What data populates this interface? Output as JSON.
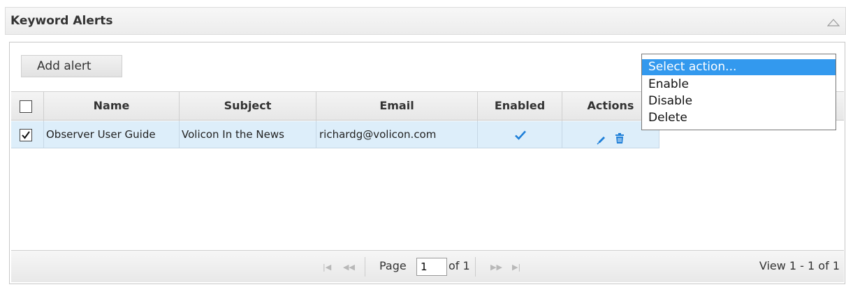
{
  "panel": {
    "title": "Keyword Alerts"
  },
  "toolbar": {
    "add_label": "Add alert"
  },
  "grid": {
    "columns": [
      "Name",
      "Subject",
      "Email",
      "Enabled",
      "Actions"
    ],
    "rows": [
      {
        "checked": true,
        "name": "Observer User Guide",
        "subject": "Volicon In the News",
        "email": "richardg@volicon.com",
        "enabled": true
      }
    ]
  },
  "pager": {
    "page_label": "Page",
    "page_value": "1",
    "of_label": "of 1",
    "view_label": "View 1 - 1 of 1"
  },
  "action_menu": {
    "options": [
      "Select action...",
      "Enable",
      "Disable",
      "Delete"
    ],
    "selected_index": 0
  },
  "colors": {
    "accent": "#3399ee",
    "row_highlight": "#ddeefa",
    "icon_blue": "#1e7fd8"
  }
}
